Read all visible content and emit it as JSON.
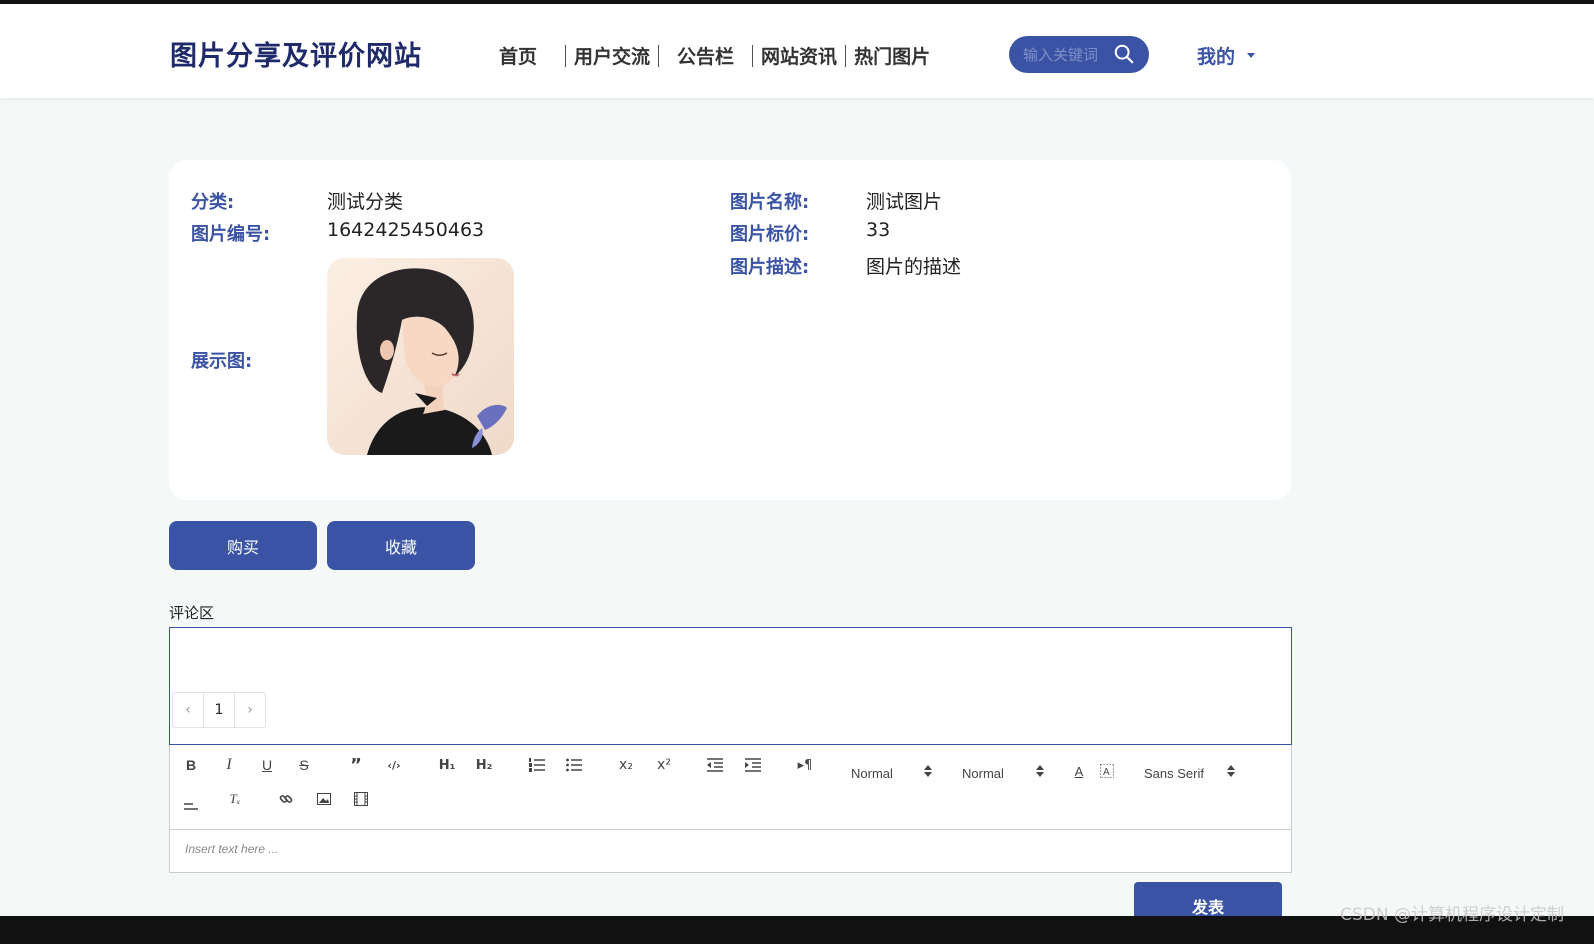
{
  "header": {
    "logo": "图片分享及评价网站",
    "nav": [
      "首页",
      "用户交流",
      "公告栏",
      "网站资讯",
      "热门图片"
    ],
    "search_placeholder": "输入关键词",
    "user_menu": "我的"
  },
  "detail": {
    "category_label": "分类:",
    "category_value": "测试分类",
    "id_label": "图片编号:",
    "id_value": "1642425450463",
    "display_label": "展示图:",
    "name_label": "图片名称:",
    "name_value": "测试图片",
    "price_label": "图片标价:",
    "price_value": "33",
    "desc_label": "图片描述:",
    "desc_value": "图片的描述"
  },
  "actions": {
    "buy": "购买",
    "favorite": "收藏"
  },
  "comments": {
    "title": "评论区",
    "pager": {
      "prev": "‹",
      "page": "1",
      "next": "›"
    }
  },
  "editor": {
    "header_size": "Normal",
    "text_size": "Normal",
    "font": "Sans Serif",
    "placeholder": "Insert text here ...",
    "submit": "发表"
  },
  "colors": {
    "accent": "#3a53a4",
    "logo": "#1f2a6b",
    "background": "#f4f9f8"
  },
  "watermark": "CSDN @计算机程序设计定制"
}
